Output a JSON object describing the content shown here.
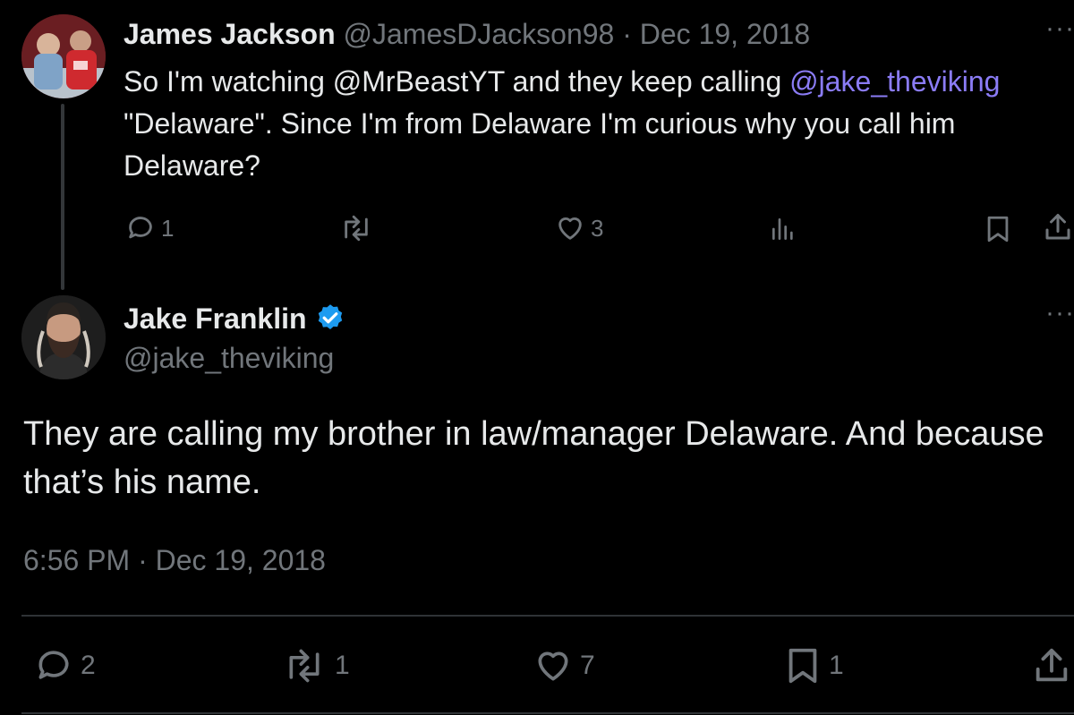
{
  "parent": {
    "author_name": "James Jackson",
    "handle": "@JamesDJackson98",
    "separator": "·",
    "date": "Dec 19, 2018",
    "more": "···",
    "text_part1": "So I'm watching @MrBeastYT and they keep calling ",
    "mention": "@jake_theviking",
    "text_part2": " \"Delaware\". Since I'm from Delaware I'm curious why you call him Delaware?",
    "replies": "1",
    "reposts": "",
    "likes": "3"
  },
  "main": {
    "author_name": "Jake Franklin",
    "handle": "@jake_theviking",
    "more": "···",
    "text": "They are calling my brother in law/manager Delaware. And because that’s his name.",
    "timestamp": "6:56 PM · Dec 19, 2018",
    "replies": "2",
    "reposts": "1",
    "likes": "7",
    "bookmarks": "1"
  },
  "colors": {
    "background": "#000000",
    "text": "#e7e9ea",
    "muted": "#71767b",
    "mention": "#8b7cf6",
    "verified": "#1d9bf0"
  }
}
